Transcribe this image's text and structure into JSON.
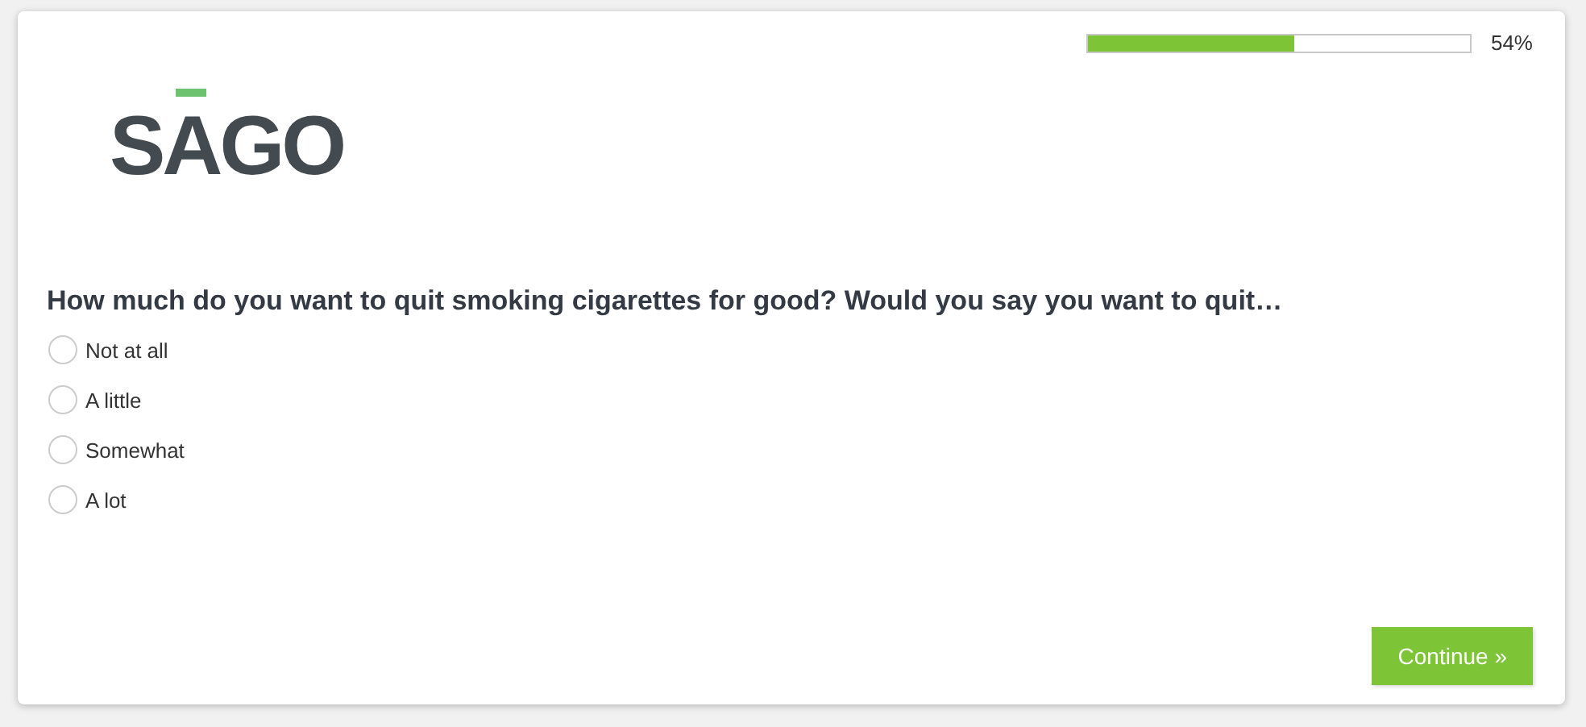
{
  "progress": {
    "level": 0.54,
    "label": "54%"
  },
  "logo": {
    "text": "SAGO"
  },
  "question": "How much do you want to quit smoking cigarettes for good? Would you say you want to quit…",
  "options": [
    {
      "label": "Not at all",
      "selected": false
    },
    {
      "label": "A little",
      "selected": false
    },
    {
      "label": "Somewhat",
      "selected": false
    },
    {
      "label": "A lot",
      "selected": false
    }
  ],
  "continue_button": "Continue »"
}
